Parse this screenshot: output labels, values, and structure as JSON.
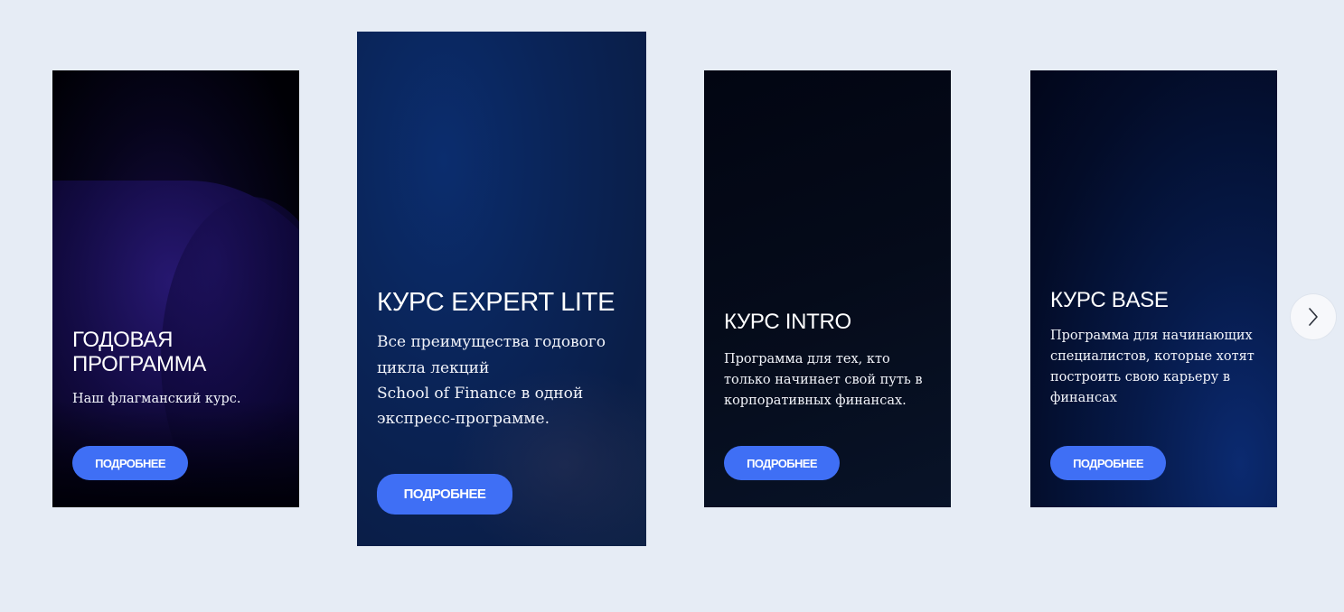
{
  "cards": [
    {
      "title": "ГОДОВАЯ ПРОГРАММА",
      "description": "Наш флагманский курс.",
      "button": "ПОДРОБНЕЕ"
    },
    {
      "title": "КУРС EXPERT LITE",
      "description": "Все преимущества годового\nцикла лекций\nSchool of Finance в одной\nэкспресс-программе.",
      "button": "ПОДРОБНЕЕ"
    },
    {
      "title": "КУРС INTRO",
      "description": "Программа для тех, кто только начинает свой путь в корпоративных финансах.",
      "button": "ПОДРОБНЕЕ"
    },
    {
      "title": "КУРС BASE",
      "description": "Программа для начинающих специалистов, которые хотят построить свою карьеру в финансах",
      "button": "ПОДРОБНЕЕ"
    }
  ],
  "carousel": {
    "next_icon": "chevron-right-icon"
  },
  "colors": {
    "page_background": "#e6ecf5",
    "button": "#3f6ff5",
    "text": "#ffffff"
  }
}
